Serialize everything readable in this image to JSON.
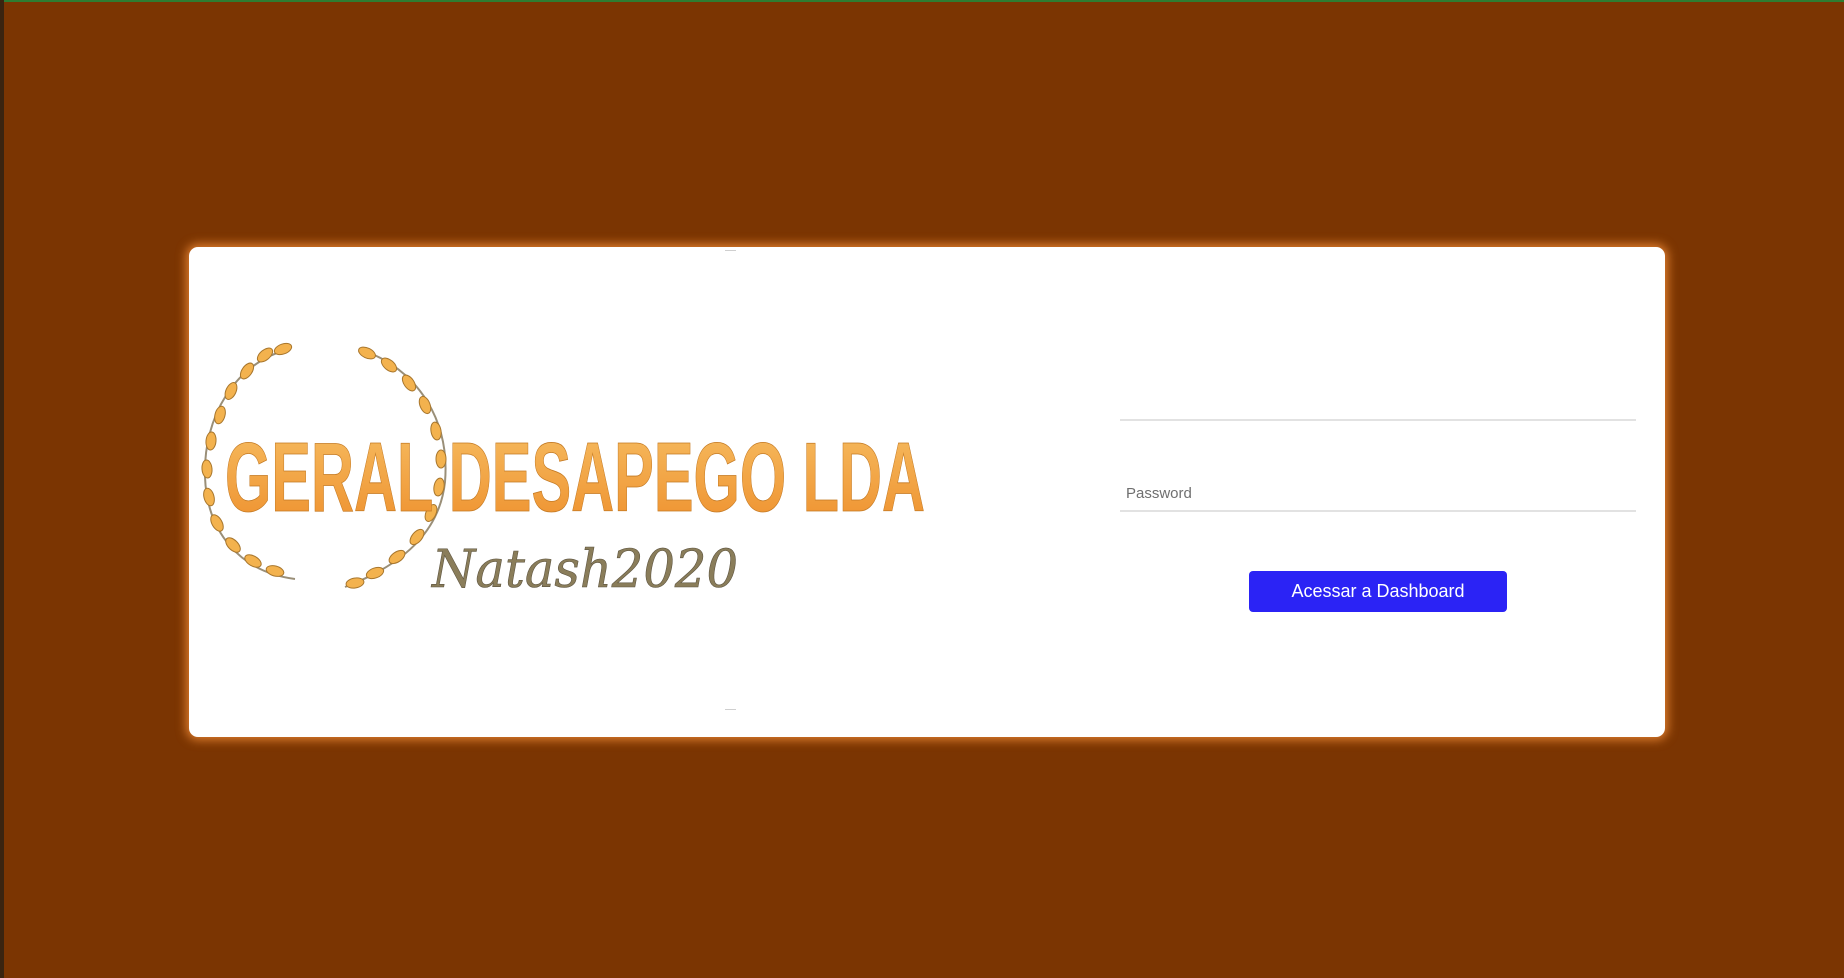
{
  "page": {
    "background_color": "#7b3502",
    "card_color": "#ffffff",
    "accent_color": "#2b23f5"
  },
  "logo": {
    "company_name": "GERAL DESAPEGO LDA",
    "tagline": "Natash2020",
    "text_colors": [
      "#f0a541",
      "#8a7d5a"
    ],
    "icon": "laurel-wreath-icon"
  },
  "login": {
    "username_placeholder": "",
    "username_value": "",
    "password_placeholder": "Password",
    "password_value": "",
    "submit_label": "Acessar a Dashboard"
  }
}
